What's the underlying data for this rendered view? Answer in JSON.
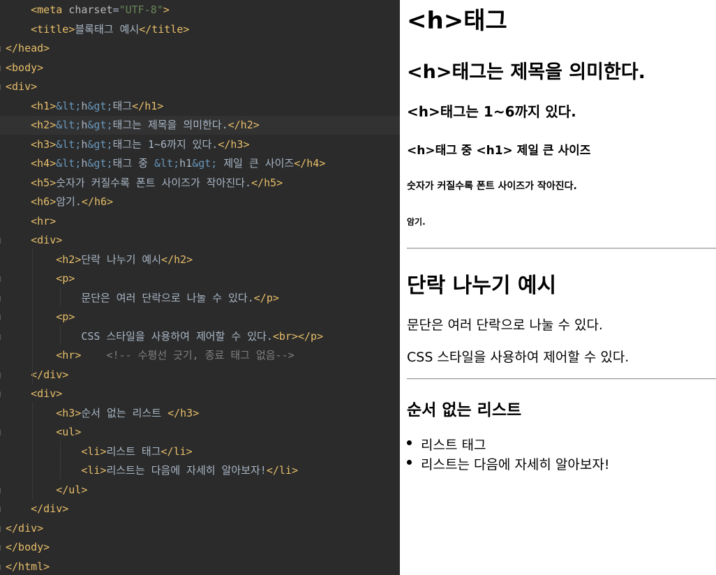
{
  "editor": {
    "lines": [
      {
        "segs": [
          {
            "t": "    "
          },
          {
            "t": "<meta",
            "c": "tag"
          },
          {
            "t": " charset",
            "c": "attr"
          },
          {
            "t": "=",
            "c": "text"
          },
          {
            "t": "\"UTF-8\"",
            "c": "val"
          },
          {
            "t": ">",
            "c": "tag"
          }
        ]
      },
      {
        "segs": [
          {
            "t": "    "
          },
          {
            "t": "<title>",
            "c": "tag"
          },
          {
            "t": "블록태그 예시",
            "c": "text"
          },
          {
            "t": "</title>",
            "c": "tag"
          }
        ]
      },
      {
        "segs": [
          {
            "t": "</head>",
            "c": "tag"
          }
        ],
        "fold": true
      },
      {
        "segs": [
          {
            "t": "<body>",
            "c": "tag"
          }
        ],
        "fold": true
      },
      {
        "segs": [
          {
            "t": "<div>",
            "c": "tag"
          }
        ],
        "fold": true
      },
      {
        "segs": [
          {
            "t": "    "
          },
          {
            "t": "<h1>",
            "c": "tag"
          },
          {
            "t": "&lt;",
            "c": "ent"
          },
          {
            "t": "h",
            "c": "text"
          },
          {
            "t": "&gt;",
            "c": "ent"
          },
          {
            "t": "태그",
            "c": "text"
          },
          {
            "t": "</h1>",
            "c": "tag"
          }
        ]
      },
      {
        "segs": [
          {
            "t": "    "
          },
          {
            "t": "<h2>",
            "c": "tag"
          },
          {
            "t": "&lt;",
            "c": "ent"
          },
          {
            "t": "h",
            "c": "text"
          },
          {
            "t": "&gt;",
            "c": "ent"
          },
          {
            "t": "태그는 제목을 의미한다.",
            "c": "text"
          },
          {
            "t": "</h2>",
            "c": "tag"
          }
        ],
        "highlight": true
      },
      {
        "segs": [
          {
            "t": "    "
          },
          {
            "t": "<h3>",
            "c": "tag"
          },
          {
            "t": "&lt;",
            "c": "ent"
          },
          {
            "t": "h",
            "c": "text"
          },
          {
            "t": "&gt;",
            "c": "ent"
          },
          {
            "t": "태그는 1~6까지 있다.",
            "c": "text"
          },
          {
            "t": "</h3>",
            "c": "tag"
          }
        ]
      },
      {
        "segs": [
          {
            "t": "    "
          },
          {
            "t": "<h4>",
            "c": "tag"
          },
          {
            "t": "&lt;",
            "c": "ent"
          },
          {
            "t": "h",
            "c": "text"
          },
          {
            "t": "&gt;",
            "c": "ent"
          },
          {
            "t": "태그 중 ",
            "c": "text"
          },
          {
            "t": "&lt;",
            "c": "ent"
          },
          {
            "t": "h1",
            "c": "text"
          },
          {
            "t": "&gt;",
            "c": "ent"
          },
          {
            "t": " 제일 큰 사이즈",
            "c": "text"
          },
          {
            "t": "</h4>",
            "c": "tag"
          }
        ]
      },
      {
        "segs": [
          {
            "t": "    "
          },
          {
            "t": "<h5>",
            "c": "tag"
          },
          {
            "t": "숫자가 커질수록 폰트 사이즈가 작아진다.",
            "c": "text"
          },
          {
            "t": "</h5>",
            "c": "tag"
          }
        ]
      },
      {
        "segs": [
          {
            "t": "    "
          },
          {
            "t": "<h6>",
            "c": "tag"
          },
          {
            "t": "암기.",
            "c": "text"
          },
          {
            "t": "</h6>",
            "c": "tag"
          }
        ]
      },
      {
        "segs": [
          {
            "t": "    "
          },
          {
            "t": "<hr>",
            "c": "tag"
          }
        ]
      },
      {
        "segs": [
          {
            "t": "    "
          },
          {
            "t": "<div>",
            "c": "tag"
          }
        ],
        "fold": true
      },
      {
        "segs": [
          {
            "t": "        "
          },
          {
            "t": "<h2>",
            "c": "tag"
          },
          {
            "t": "단락 나누기 예시",
            "c": "text"
          },
          {
            "t": "</h2>",
            "c": "tag"
          }
        ]
      },
      {
        "segs": [
          {
            "t": "        "
          },
          {
            "t": "<p>",
            "c": "tag"
          }
        ],
        "fold": true
      },
      {
        "segs": [
          {
            "t": "            "
          },
          {
            "t": "문단은 여러 단락으로 나눌 수 있다.",
            "c": "text"
          },
          {
            "t": "</p>",
            "c": "tag"
          }
        ],
        "fold": true
      },
      {
        "segs": [
          {
            "t": "        "
          },
          {
            "t": "<p>",
            "c": "tag"
          }
        ],
        "fold": true
      },
      {
        "segs": [
          {
            "t": "            "
          },
          {
            "t": "CSS 스타일을 사용하여 제어할 수 있다.",
            "c": "text"
          },
          {
            "t": "<br></p>",
            "c": "tag"
          }
        ],
        "fold": true
      },
      {
        "segs": [
          {
            "t": "        "
          },
          {
            "t": "<hr>",
            "c": "tag"
          },
          {
            "t": "    "
          },
          {
            "t": "<!-- 수평선 긋기, 종료 태그 없음-->",
            "c": "cmt"
          }
        ]
      },
      {
        "segs": [
          {
            "t": "    "
          },
          {
            "t": "</div>",
            "c": "tag"
          }
        ],
        "fold": true
      },
      {
        "segs": [
          {
            "t": "    "
          },
          {
            "t": "<div>",
            "c": "tag"
          }
        ],
        "fold": true
      },
      {
        "segs": [
          {
            "t": "        "
          },
          {
            "t": "<h3>",
            "c": "tag"
          },
          {
            "t": "순서 없는 리스트 ",
            "c": "text"
          },
          {
            "t": "</h3>",
            "c": "tag"
          }
        ]
      },
      {
        "segs": [
          {
            "t": "        "
          },
          {
            "t": "<ul>",
            "c": "tag"
          }
        ],
        "fold": true
      },
      {
        "segs": [
          {
            "t": "            "
          },
          {
            "t": "<li>",
            "c": "tag"
          },
          {
            "t": "리스트 태그",
            "c": "text"
          },
          {
            "t": "</li>",
            "c": "tag"
          }
        ]
      },
      {
        "segs": [
          {
            "t": "            "
          },
          {
            "t": "<li>",
            "c": "tag"
          },
          {
            "t": "리스트는 다음에 자세히 알아보자!",
            "c": "text"
          },
          {
            "t": "</li>",
            "c": "tag"
          }
        ]
      },
      {
        "segs": [
          {
            "t": "        "
          },
          {
            "t": "</ul>",
            "c": "tag"
          }
        ],
        "fold": true
      },
      {
        "segs": [
          {
            "t": "    "
          },
          {
            "t": "</div>",
            "c": "tag"
          }
        ],
        "fold": true
      },
      {
        "segs": [
          {
            "t": "</div>",
            "c": "tag"
          }
        ],
        "fold": true
      },
      {
        "segs": [
          {
            "t": "</body>",
            "c": "tag"
          }
        ],
        "fold": true
      },
      {
        "segs": [
          {
            "t": "</html>",
            "c": "tag"
          }
        ],
        "fold": true
      }
    ]
  },
  "colors": {
    "editor_bg": "#2b2b2b",
    "tag": "#e8bf6a",
    "attr": "#bababa",
    "string": "#6a8759",
    "entity": "#6897bb",
    "text": "#a9b7c6",
    "comment": "#808080",
    "highlight_line": "#323232"
  },
  "preview": {
    "h1": "<h>태그",
    "h2": "<h>태그는 제목을 의미한다.",
    "h3": "<h>태그는 1~6까지 있다.",
    "h4": "<h>태그 중 <h1> 제일 큰 사이즈",
    "h5": "숫자가 커질수록 폰트 사이즈가 작아진다.",
    "h6": "암기.",
    "section_h2": "단락 나누기 예시",
    "p1": "문단은 여러 단락으로 나눌 수 있다.",
    "p2": "CSS 스타일을 사용하여 제어할 수 있다.",
    "section_h3": "순서 없는 리스트",
    "list": [
      "리스트 태그",
      "리스트는 다음에 자세히 알아보자!"
    ]
  }
}
